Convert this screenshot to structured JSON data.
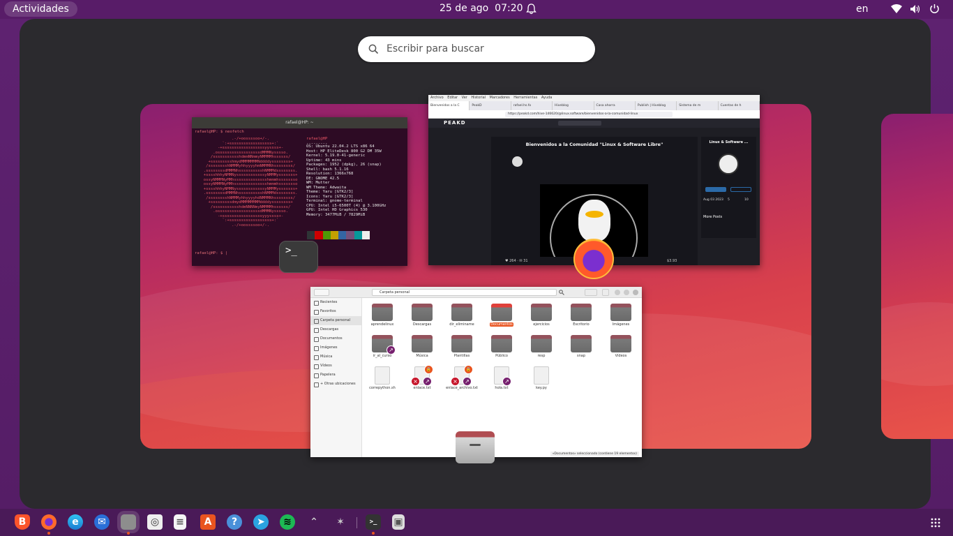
{
  "topbar": {
    "activities": "Actividades",
    "date": "25 de ago",
    "time": "07:20",
    "lang": "en"
  },
  "search": {
    "placeholder": "Escribir para buscar"
  },
  "terminal": {
    "title": "rafael@HP: ~",
    "prompt": "rafael@HP: $ neofetch",
    "user": "rafael@HP",
    "sep": "---------",
    "info": [
      "OS: Ubuntu 22.04.2 LTS x86 64",
      "Host: HP EliteDesk 800 G2 DM 35W",
      "Kernel: 5.19.0-41-generic",
      "Uptime: 43 mins",
      "Packages: 1952 (dpkg), 26 (snap)",
      "Shell: bash 5.1.16",
      "Resolution: 1366x768",
      "DE: GNOME 42.5",
      "WM: Mutter",
      "WM Theme: Adwaita",
      "Theme: Yaru [GTK2/3]",
      "Icons: Yaru [GTK2/3]",
      "Terminal: gnome-terminal",
      "CPU: Intel i5-6500T (4) @ 3.100GHz",
      "GPU: Intel HD Graphics 530",
      "Memory: 3477MiB / 7829MiB"
    ],
    "prompt2": "rafael@HP: $ |"
  },
  "firefox": {
    "menu": "Archivo Editar Ver Historial Marcadores Herramientas Ayuda",
    "tabs": [
      "Bienvenidos a la C",
      "PeakD",
      "rafael.hs.fo",
      "Hiveblog",
      "Casa ahorra",
      "Publish | Hiveblog",
      "Sistema de m",
      "Cuentas de h"
    ],
    "url": "https://peakd.com/hive-146620/@linux.software/bienvenidos-a-la-comunidad-linux",
    "brand": "PEAKD",
    "post_title": "Bienvenidos a la Comunidad \"Linux & Software Libre\"",
    "community": "Linux & Software ...",
    "recent": "More Posts",
    "stats": [
      "Aug 03 2023",
      "5",
      "10"
    ],
    "votes": "264",
    "comments": "31",
    "value": "$3.93"
  },
  "files": {
    "path": "Carpeta personal",
    "sidebar": [
      "Recientes",
      "Favoritos",
      "Carpeta personal",
      "Descargas",
      "Documentos",
      "Imágenes",
      "Música",
      "Vídeos",
      "Papelera",
      "+ Otras ubicaciones"
    ],
    "items": [
      {
        "label": "aprendelinux",
        "kind": "folder"
      },
      {
        "label": "Descargas",
        "kind": "folder"
      },
      {
        "label": "dir_eliminame",
        "kind": "folder"
      },
      {
        "label": "Documentos",
        "kind": "folder-selected"
      },
      {
        "label": "ejercicios",
        "kind": "folder"
      },
      {
        "label": "Escritorio",
        "kind": "folder"
      },
      {
        "label": "Imágenes",
        "kind": "folder"
      },
      {
        "label": "ir_al_curso",
        "kind": "folder-link"
      },
      {
        "label": "Música",
        "kind": "folder"
      },
      {
        "label": "Plantillas",
        "kind": "folder"
      },
      {
        "label": "Público",
        "kind": "folder"
      },
      {
        "label": "resp",
        "kind": "folder"
      },
      {
        "label": "snap",
        "kind": "folder"
      },
      {
        "label": "Vídeos",
        "kind": "folder"
      },
      {
        "label": "correpython.sh",
        "kind": "doc"
      },
      {
        "label": "enlace.txt",
        "kind": "broken"
      },
      {
        "label": "enlace_archivo.txt",
        "kind": "broken"
      },
      {
        "label": "hola.txt",
        "kind": "doc-link"
      },
      {
        "label": "key.py",
        "kind": "doc"
      }
    ],
    "status": "«Documentos» seleccionado (contiene 19 elementos)"
  },
  "dock": [
    "brave-icon",
    "firefox-icon",
    "edge-icon",
    "thunderbird-icon",
    "files-icon",
    "screenshot-icon",
    "text-editor-icon",
    "software-icon",
    "help-icon",
    "telegram-icon",
    "spotify-icon",
    "arrow-icon",
    "bug-icon",
    "terminal-icon",
    "storage-icon"
  ],
  "colors": {
    "accent": "#e95420",
    "topbar": "#581c68",
    "overview": "#2b2a2e"
  }
}
